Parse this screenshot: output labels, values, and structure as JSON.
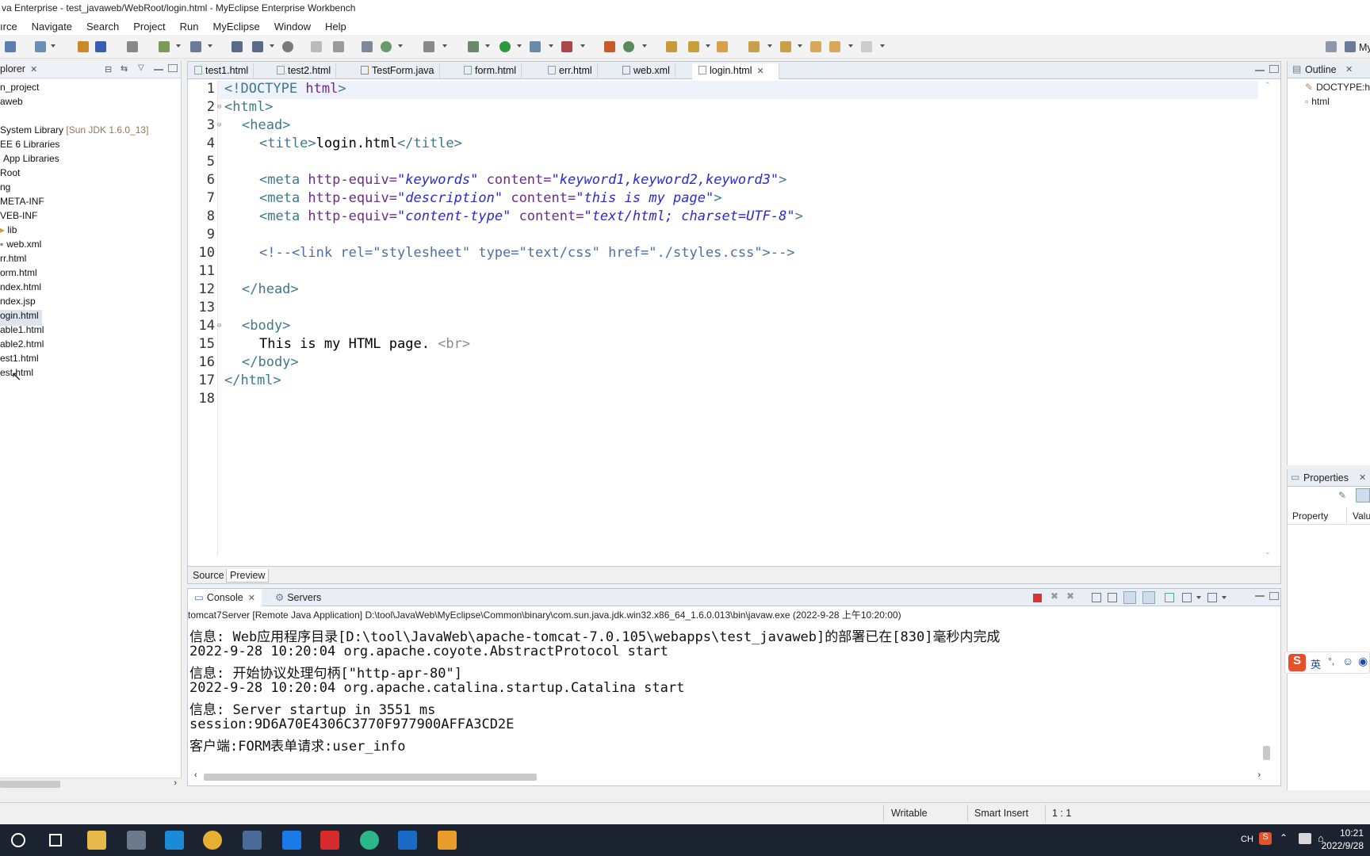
{
  "window": {
    "title": "va Enterprise - test_javaweb/WebRoot/login.html - MyEclipse Enterprise Workbench"
  },
  "menu": [
    "ırce",
    "Navigate",
    "Search",
    "Project",
    "Run",
    "MyEclipse",
    "Window",
    "Help"
  ],
  "explorer": {
    "title": "plorer",
    "items": [
      {
        "label": "n_project"
      },
      {
        "label": "aweb"
      },
      {
        "label": "System Library",
        "extra": "[Sun JDK 1.6.0_13]"
      },
      {
        "label": "EE 6 Libraries"
      },
      {
        "label": "App Libraries"
      },
      {
        "label": "Root"
      },
      {
        "label": "ng"
      },
      {
        "label": "META-INF"
      },
      {
        "label": "VEB-INF"
      },
      {
        "label": "lib"
      },
      {
        "label": "web.xml"
      },
      {
        "label": "rr.html"
      },
      {
        "label": "orm.html"
      },
      {
        "label": "ndex.html"
      },
      {
        "label": "ndex.jsp"
      },
      {
        "label": "ogin.html"
      },
      {
        "label": "able1.html"
      },
      {
        "label": "able2.html"
      },
      {
        "label": "est1.html"
      },
      {
        "label": "est.html"
      }
    ]
  },
  "editor": {
    "tabs": [
      {
        "label": "test1.html"
      },
      {
        "label": "test2.html"
      },
      {
        "label": "TestForm.java"
      },
      {
        "label": "form.html"
      },
      {
        "label": "err.html"
      },
      {
        "label": "web.xml"
      },
      {
        "label": "login.html"
      }
    ],
    "active_tab": "login.html",
    "line_numbers": [
      "1",
      "2",
      "3",
      "4",
      "5",
      "6",
      "7",
      "8",
      "9",
      "10",
      "11",
      "12",
      "13",
      "14",
      "15",
      "16",
      "17",
      "18"
    ],
    "code": {
      "l1_a": "<!DOCTYPE ",
      "l1_b": "html",
      "l1_c": ">",
      "l2": "<html>",
      "l3": "<head>",
      "l4_a": "<title>",
      "l4_b": "login.html",
      "l4_c": "</title>",
      "meta_open": "<meta ",
      "http_equiv": "http-equiv=",
      "content_attr": "content=",
      "close": ">",
      "l6_v1": "\"keywords\"",
      "l6_v2": "\"keyword1,keyword2,keyword3\"",
      "l7_v1": "\"description\"",
      "l7_v2": "\"this is my page\"",
      "l8_v1": "\"content-type\"",
      "l8_v2": "\"text/html; charset=UTF-8\"",
      "l10": "<!--<link rel=\"stylesheet\" type=\"text/css\" href=\"./styles.css\">-->",
      "l12": "</head>",
      "l14": "<body>",
      "l15_a": "This is my HTML page. ",
      "l15_b": "<br>",
      "l16": "</body>",
      "l17": "</html>"
    },
    "bottom_tabs": [
      "Source",
      "Preview"
    ]
  },
  "console": {
    "tabs": [
      "Console",
      "Servers"
    ],
    "process": "tomcat7Server [Remote Java Application] D:\\tool\\JavaWeb\\MyEclipse\\Common\\binary\\com.sun.java.jdk.win32.x86_64_1.6.0.013\\bin\\javaw.exe (2022-9-28 上午10:20:00)",
    "lines": [
      "信息: Web应用程序目录[D:\\tool\\JavaWeb\\apache-tomcat-7.0.105\\webapps\\test_javaweb]的部署已在[830]毫秒内完成",
      "2022-9-28 10:20:04 org.apache.coyote.AbstractProtocol start",
      "信息: 开始协议处理句柄[\"http-apr-80\"]",
      "2022-9-28 10:20:04 org.apache.catalina.startup.Catalina start",
      "信息: Server startup in 3551 ms",
      "session:9D6A70E4306C3770F977900AFFA3CD2E",
      "客户端:FORM表单请求:user_info"
    ]
  },
  "outline": {
    "title": "Outline",
    "items": [
      "DOCTYPE:h",
      "html"
    ]
  },
  "properties": {
    "title": "Properties",
    "col_property": "Property",
    "col_value": "Valu"
  },
  "status": {
    "writable": "Writable",
    "insert_mode": "Smart Insert",
    "position": "1 : 1"
  },
  "ime": {
    "lang": "英"
  },
  "taskbar": {
    "lang": "CH",
    "time": "10:21",
    "date": "2022/9/28"
  },
  "right_toolbar_label": "My"
}
